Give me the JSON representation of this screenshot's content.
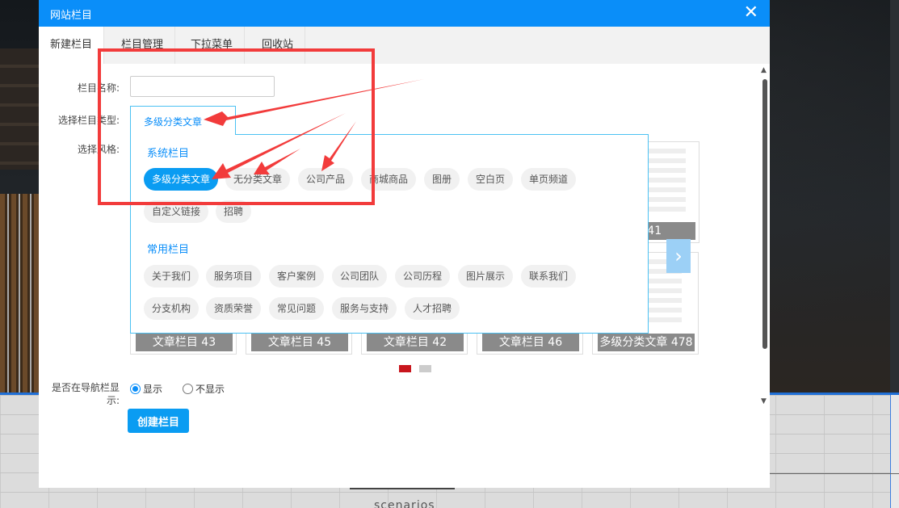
{
  "background": {
    "caption": "scenarios"
  },
  "dialog": {
    "title": "网站栏目",
    "close_label": "✕"
  },
  "tabs": [
    {
      "label": "新建栏目"
    },
    {
      "label": "栏目管理"
    },
    {
      "label": "下拉菜单"
    },
    {
      "label": "回收站"
    }
  ],
  "form": {
    "name_label": "栏目名称:",
    "name_value": "",
    "type_label": "选择栏目类型:",
    "type_selected": "多级分类文章",
    "style_label": "选择风格:",
    "nav_label_line1": "是否在导航栏显",
    "nav_label_line2": "示:",
    "nav_show": "显示",
    "nav_hide": "不显示",
    "create_button": "创建栏目"
  },
  "dropdown": {
    "system_title": "系统栏目",
    "system_items": [
      "多级分类文章",
      "无分类文章",
      "公司产品",
      "商城商品",
      "图册",
      "空白页",
      "单页频道",
      "自定义链接",
      "招聘"
    ],
    "common_title": "常用栏目",
    "common_items": [
      "关于我们",
      "服务项目",
      "客户案例",
      "公司团队",
      "公司历程",
      "图片展示",
      "联系我们",
      "分支机构",
      "资质荣誉",
      "常见问题",
      "服务与支持",
      "人才招聘"
    ]
  },
  "style_cards": {
    "top_right_caption": "目 41",
    "bottom_captions": [
      "文章栏目 43",
      "文章栏目 45",
      "文章栏目 42",
      "文章栏目 46",
      "多级分类文章 478"
    ]
  },
  "icons": {
    "next": "next-arrow-icon",
    "close": "close-icon"
  },
  "colors": {
    "accent": "#0a8ef9",
    "annotation": "#f23b3b",
    "active_dot": "#c8161d",
    "inactive_dot": "#cccccc"
  }
}
